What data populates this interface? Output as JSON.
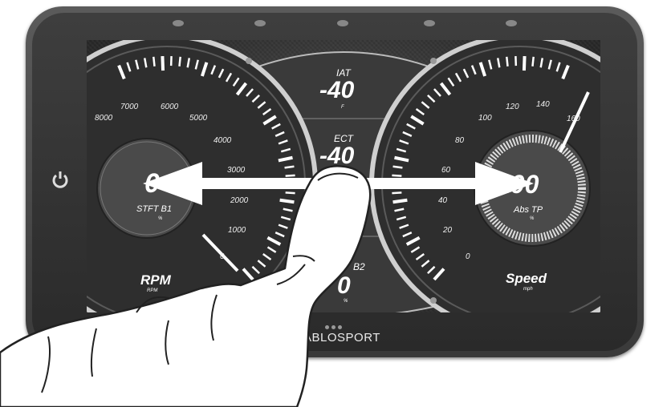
{
  "device": {
    "brand": "ABLOSPORT",
    "home_button_icon": "power-icon"
  },
  "gauges": {
    "rpm": {
      "label": "RPM",
      "unit": "RPM",
      "ticks": [
        "8000",
        "7000",
        "6000",
        "5000",
        "4000",
        "3000",
        "2000",
        "1000",
        "0"
      ],
      "inner_value": "0",
      "inner_label": "STFT B1",
      "inner_unit": "%"
    },
    "speed": {
      "label": "Speed",
      "unit": "mph",
      "ticks": [
        "160",
        "140",
        "120",
        "100",
        "80",
        "60",
        "40",
        "20",
        "0"
      ],
      "inner_value": "100",
      "inner_label": "Abs TP",
      "inner_unit": "%"
    },
    "center": {
      "iat_label": "IAT",
      "iat_value": "-40",
      "iat_unit": "F",
      "ect_label": "ECT",
      "ect_value": "-40",
      "b2_label": "B2",
      "b2_value": "0",
      "b2_unit": "%"
    }
  },
  "gesture": {
    "type": "swipe-horizontal",
    "hand_icon": "pointing-hand-icon",
    "arrow_icon": "double-arrow-icon"
  }
}
